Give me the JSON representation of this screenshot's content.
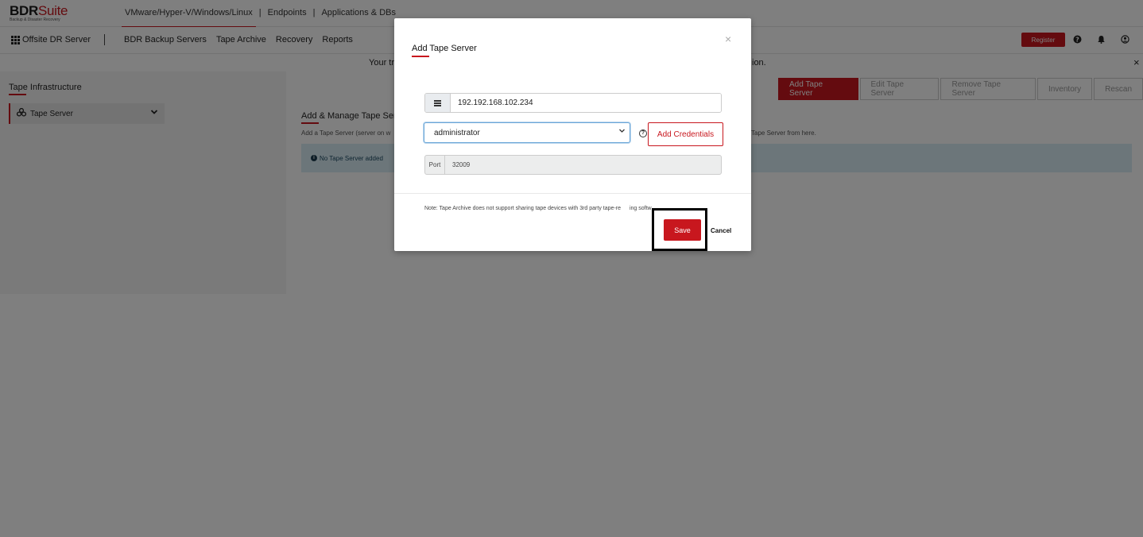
{
  "brand": {
    "name_main": "BDR",
    "name_suite": "Suite",
    "tagline": "Backup & Disaster Recovery"
  },
  "product_nav": {
    "active": "VMware/Hyper-V/Windows/Linux",
    "items": [
      "Endpoints",
      "Applications & DBs"
    ],
    "separator": "|"
  },
  "navbar": {
    "site": "Offsite DR Server",
    "menu": [
      "BDR Backup Servers",
      "Tape Archive",
      "Recovery",
      "Reports"
    ],
    "register": "Register"
  },
  "banner": {
    "text_left": "Your tr",
    "text_right": "ion.",
    "close": "×"
  },
  "sidebar": {
    "heading": "Tape Infrastructure",
    "item": "Tape Server"
  },
  "main": {
    "toolbar": [
      "Add Tape Server",
      "Edit Tape Server",
      "Remove Tape Server",
      "Inventory",
      "Rescan"
    ],
    "section_title": "Add & Manage Tape Serve",
    "desc_left": "Add a Tape Server (server on w",
    "desc_right": "Tape Server from here.",
    "alert": "No Tape Server added"
  },
  "modal": {
    "title": "Add Tape Server",
    "close": "×",
    "host_value": "192.192.168.102.234",
    "credential_selected": "administrator",
    "add_credentials": "Add Credentials",
    "port_label": "Port",
    "port_value": "32009",
    "note": "Note: Tape Archive does not support sharing tape devices with 3rd party tape-re",
    "note_tail": "ing softw",
    "save": "Save",
    "cancel": "Cancel"
  },
  "colors": {
    "accent": "#c8171e",
    "overlay": "rgba(0,0,0,0.5)",
    "alert_bg": "#d9ecf5"
  }
}
